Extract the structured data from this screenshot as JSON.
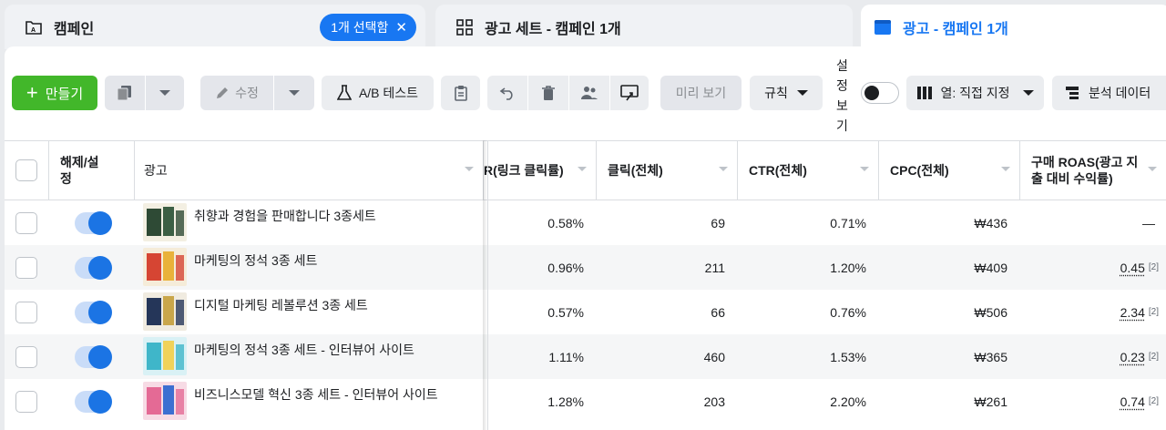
{
  "tabs": {
    "campaign": {
      "label": "캠페인",
      "selection_pill": "1개 선택함",
      "close_symbol": "✕"
    },
    "adset": {
      "label": "광고 세트 - 캠페인 1개"
    },
    "ad": {
      "label": "광고 - 캠페인 1개"
    }
  },
  "toolbar": {
    "create": "만들기",
    "create_symbol": "+",
    "edit": "수정",
    "ab_test": "A/B 테스트",
    "preview": "미리 보기",
    "rules": "규칙",
    "setting_toggle_label": "설정\n보기",
    "columns": "열: 직접 지정",
    "breakdown": "분석 데이터"
  },
  "table": {
    "headers": {
      "toggle": "해제/설정",
      "ad": "광고",
      "link_ctr": "R(링크 클릭률)",
      "clicks": "클릭(전체)",
      "ctr": "CTR(전체)",
      "cpc": "CPC(전체)",
      "roas": "구매 ROAS(광고 지출 대비 수익률)"
    },
    "rows": [
      {
        "name": "취향과 경험을 판매합니다 3종세트",
        "link_ctr": "0.58%",
        "clicks": "69",
        "ctr": "0.71%",
        "cpc": "₩436",
        "roas": "—",
        "roas_note": "",
        "thumb": "dark-green-books"
      },
      {
        "name": "마케팅의 정석 3종 세트",
        "link_ctr": "0.96%",
        "clicks": "211",
        "ctr": "1.20%",
        "cpc": "₩409",
        "roas": "0.45",
        "roas_note": "[2]",
        "thumb": "red-books"
      },
      {
        "name": "디지털 마케팅 레볼루션 3종 세트",
        "link_ctr": "0.57%",
        "clicks": "66",
        "ctr": "0.76%",
        "cpc": "₩506",
        "roas": "2.34",
        "roas_note": "[2]",
        "thumb": "navy-books"
      },
      {
        "name": "마케팅의 정석 3종 세트 - 인터뷰어 사이트",
        "link_ctr": "1.11%",
        "clicks": "460",
        "ctr": "1.53%",
        "cpc": "₩365",
        "roas": "0.23",
        "roas_note": "[2]",
        "thumb": "cyan-books"
      },
      {
        "name": "비즈니스모델 혁신 3종 세트 - 인터뷰어 사이트",
        "link_ctr": "1.28%",
        "clicks": "203",
        "ctr": "2.20%",
        "cpc": "₩261",
        "roas": "0.74",
        "roas_note": "[2]",
        "thumb": "pink-books"
      }
    ]
  },
  "colors": {
    "accent": "#1877f2",
    "create": "#42b72a",
    "toggle_knob": "#1b74e4"
  }
}
